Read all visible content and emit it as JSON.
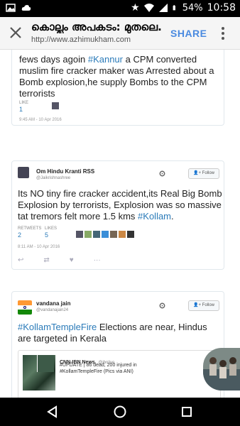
{
  "status_bar": {
    "battery": "54%",
    "time": "10:58"
  },
  "app_bar": {
    "title": "കൊല്ലം അപകടം: മുതലെ...",
    "url": "http://www.azhimukham.com",
    "share_label": "SHARE"
  },
  "tweet1": {
    "text_part1": "fews days agoin ",
    "hashtag": "#Kannur",
    "text_part2": " a CPM converted muslim fire cracker maker was Arrested  about a Bomb explosion,he supply Bombs to the CPM terrorists",
    "likes_label": "LIKE",
    "likes_count": "1",
    "timestamp": "9:45 AM - 10 Apr 2016"
  },
  "tweet2": {
    "name": "Om Hindu Kranti RSS",
    "handle": "@Jaikrishnashree",
    "follow_label": "Follow",
    "text_part1": "Its NO tiny fire cracker accident,its Real Big Bomb Explosion by terrorists, Explosion was so massive tat tremors felt more 1.5 kms ",
    "hashtag": "#Kollam",
    "text_part2": ".",
    "retweets_label": "RETWEETS",
    "retweets_count": "2",
    "likes_label": "LIKES",
    "likes_count": "5",
    "timestamp": "8:11 AM - 10 Apr 2016"
  },
  "tweet3": {
    "name": "vandana jain",
    "handle": "@vandanajain24",
    "follow_label": "Follow",
    "hashtag": "#KollamTempleFire",
    "text_part2": " Elections are near, Hindus are targeted in Kerala",
    "quoted": {
      "name": "CNN-IBN News",
      "handle": "@ibnlive",
      "text": "#UPDATE | 86 dead, 200 injured in #KollamTempleFire (Pics via ANI)"
    }
  },
  "colors": {
    "link": "#2b7bb9",
    "share": "#4a8ae0"
  }
}
